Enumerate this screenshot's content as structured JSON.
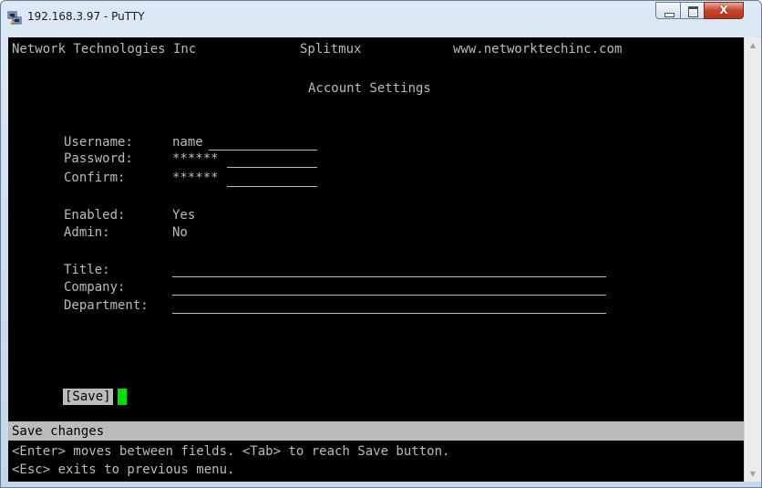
{
  "window": {
    "title": "192.168.3.97 - PuTTY",
    "icon": "putty-icon",
    "buttons": {
      "minimize": "minimize-icon",
      "maximize": "maximize-icon",
      "close_label": "X"
    }
  },
  "header": {
    "company": "Network Technologies Inc",
    "product": "Splitmux",
    "website": "www.networktechinc.com"
  },
  "page_title": "Account Settings",
  "fields": {
    "username": {
      "label": "Username:",
      "value": "name"
    },
    "password": {
      "label": "Password:",
      "value": "******"
    },
    "confirm": {
      "label": "Confirm:",
      "value": "******"
    },
    "enabled": {
      "label": "Enabled:",
      "value": "Yes"
    },
    "admin": {
      "label": "Admin:",
      "value": "No"
    },
    "title": {
      "label": "Title:",
      "value": ""
    },
    "company": {
      "label": "Company:",
      "value": ""
    },
    "department": {
      "label": "Department:",
      "value": ""
    }
  },
  "save_button": "[Save]",
  "status": "Save changes",
  "help": {
    "line1": "<Enter> moves between fields. <Tab> to reach Save button.",
    "line2": "<Esc> exits to previous menu."
  },
  "colors": {
    "terminal_bg": "#000000",
    "terminal_fg": "#bbbbbb",
    "cursor": "#00e000",
    "status_bar_bg": "#bbbbbb"
  }
}
